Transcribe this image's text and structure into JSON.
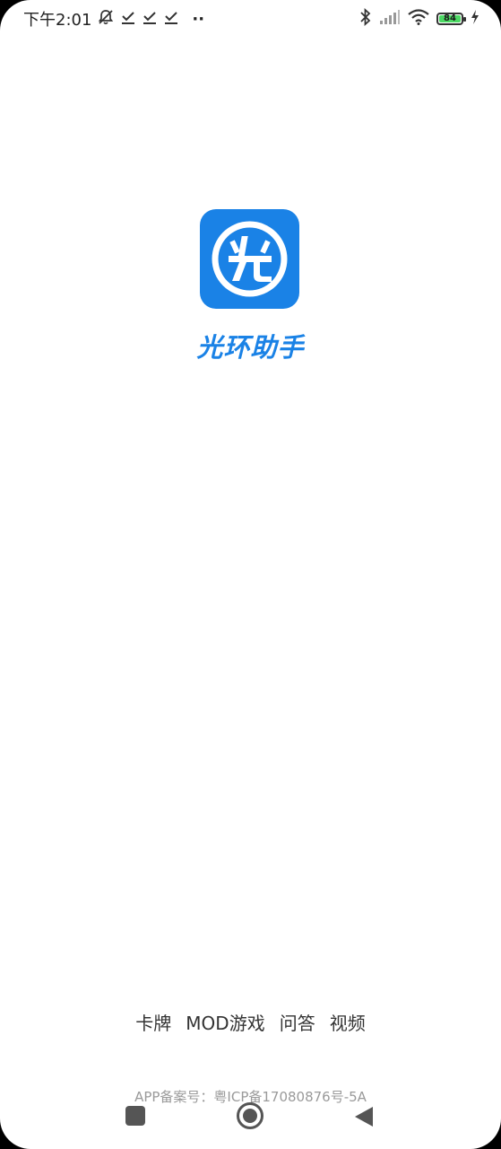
{
  "status_bar": {
    "time": "下午2:01",
    "extra_dots": "··",
    "battery_level": "84"
  },
  "app": {
    "logo_char": "光",
    "name": "光环助手"
  },
  "footer": {
    "links": [
      "卡牌",
      "MOD游戏",
      "问答",
      "视频"
    ],
    "icp": "APP备案号：粤ICP备17080876号-5A"
  },
  "colors": {
    "brand": "#1a82e6",
    "background": "#ffffff"
  }
}
